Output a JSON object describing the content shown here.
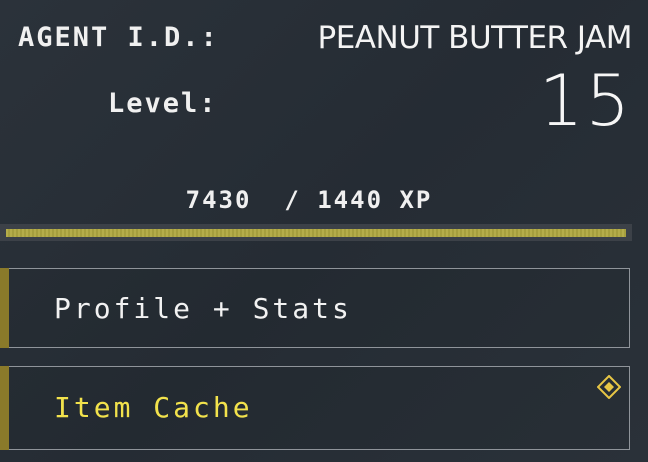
{
  "agent": {
    "id_label": "AGENT I.D.:",
    "name": "PEANUT BUTTER JAM",
    "level_label": "Level:",
    "level": "15"
  },
  "xp": {
    "text": "7430  / 1440 XP",
    "progress_fraction": 1.0
  },
  "menu": {
    "items": [
      {
        "label": "Profile + Stats"
      },
      {
        "label": "Item Cache"
      }
    ]
  },
  "icons": {
    "new_badge": "diamond-notification-icon"
  },
  "colors": {
    "background": "#262d35",
    "accent_gold": "#8a7a2a",
    "xp_bar": "#b5ad4a",
    "highlight_text": "#f2e24c",
    "badge": "#e7c645"
  }
}
